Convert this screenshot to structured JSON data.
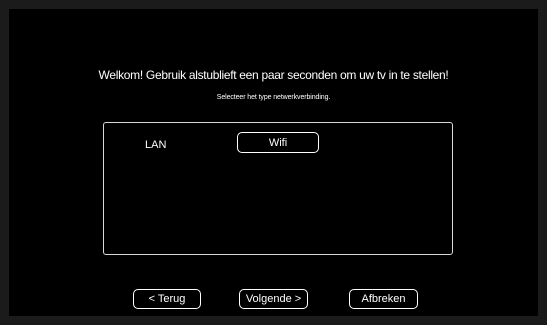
{
  "header": {
    "welcome_text": "Welkom! Gebruik alstublieft een paar seconden om uw tv in te stellen!",
    "subtitle": "Selecteer het type netwerkverbinding."
  },
  "network": {
    "lan_label": "LAN",
    "wifi_label": "Wifi"
  },
  "footer": {
    "back_label": "< Terug",
    "next_label": "Volgende >",
    "cancel_label": "Afbreken"
  },
  "colors": {
    "background": "#000000",
    "bezel": "#1b1b1b",
    "text": "#ffffff",
    "border": "#d8d8d8"
  }
}
